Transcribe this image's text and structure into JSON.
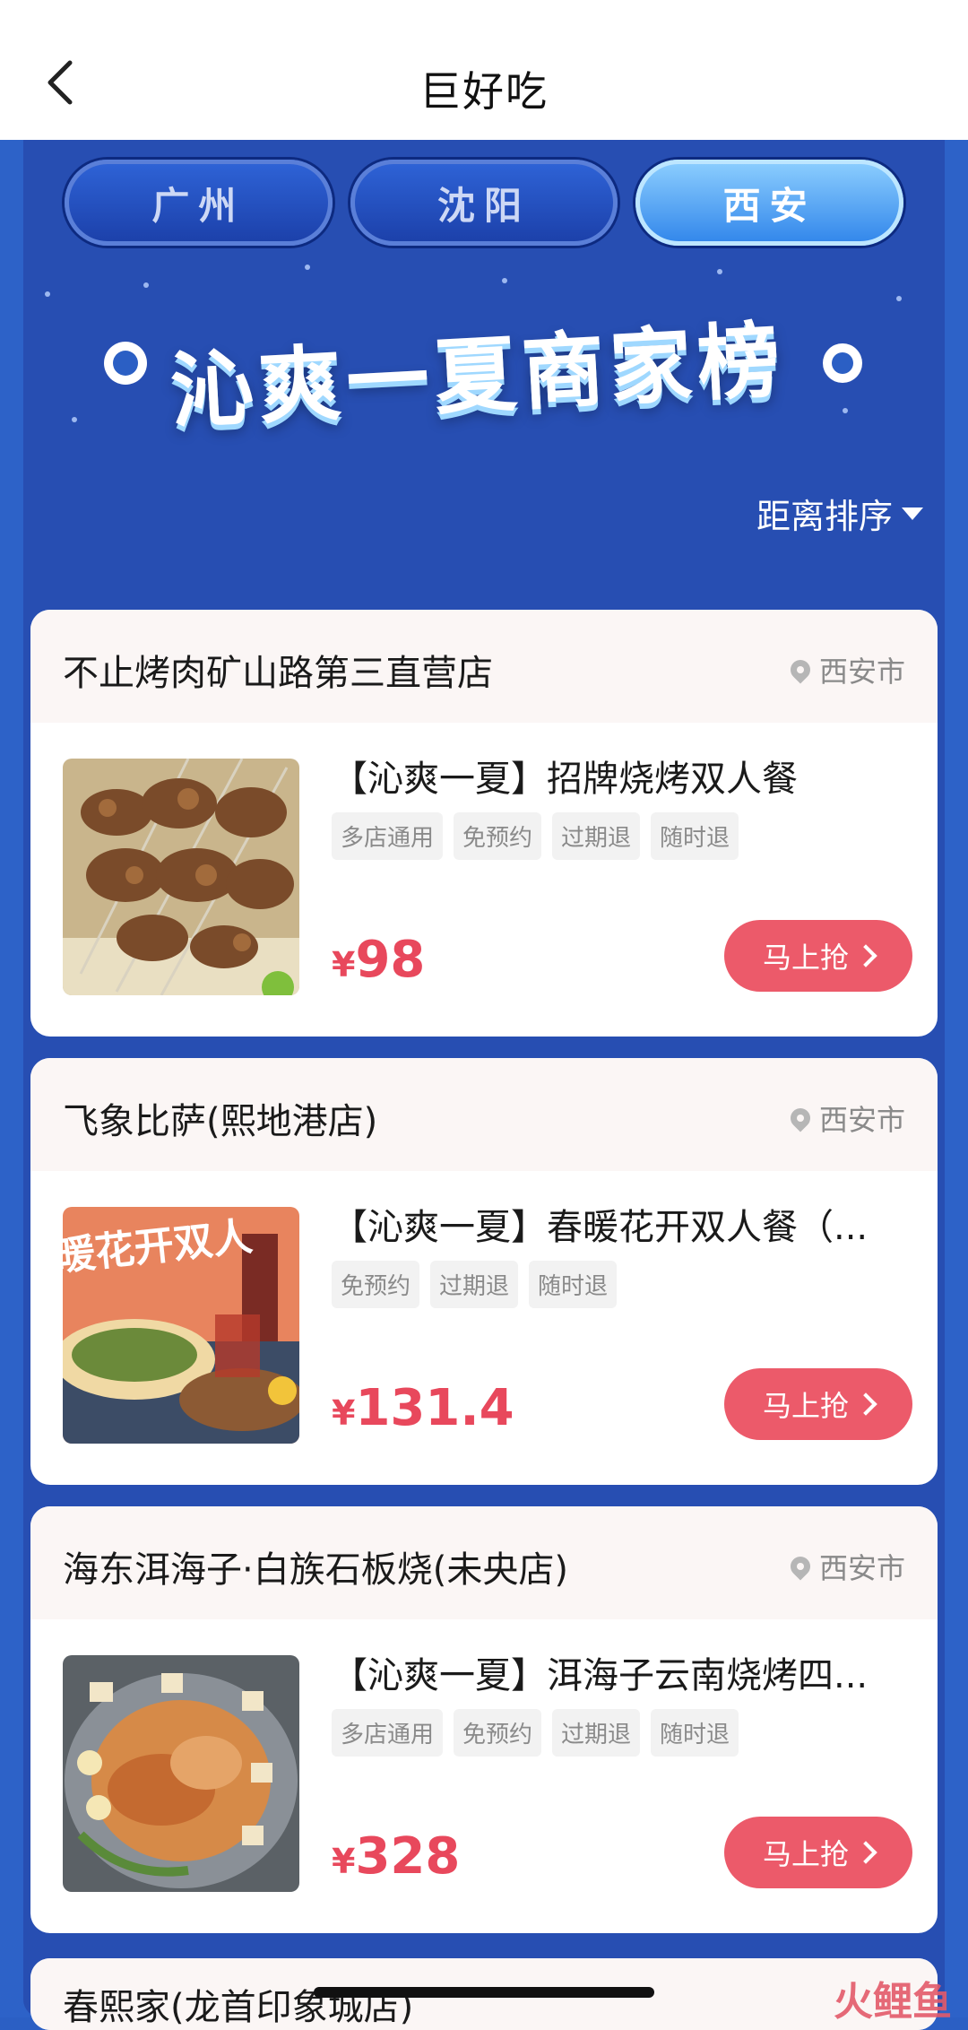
{
  "nav": {
    "title": "巨好吃"
  },
  "tabs": [
    "广州",
    "沈阳",
    "西安"
  ],
  "active_tab": "西安",
  "banner_title": "沁爽一夏商家榜",
  "sort_label": "距离排序",
  "cards": [
    {
      "store": "不止烤肉矿山路第三直营店",
      "city": "西安市",
      "deal": "【沁爽一夏】招牌烧烤双人餐",
      "tags": [
        "多店通用",
        "免预约",
        "过期退",
        "随时退"
      ],
      "currency": "¥",
      "price": "98",
      "button": "马上抢"
    },
    {
      "store": "飞象比萨(熙地港店)",
      "city": "西安市",
      "deal": "【沁爽一夏】春暖花开双人餐（...",
      "tags": [
        "免预约",
        "过期退",
        "随时退"
      ],
      "currency": "¥",
      "price": "131.4",
      "button": "马上抢",
      "image_text": "暖花开双人"
    },
    {
      "store": "海东洱海子·白族石板烧(未央店)",
      "city": "西安市",
      "deal": "【沁爽一夏】洱海子云南烧烤四...",
      "tags": [
        "多店通用",
        "免预约",
        "过期退",
        "随时退"
      ],
      "currency": "¥",
      "price": "328",
      "button": "马上抢"
    }
  ],
  "partial_card": {
    "store": "春熙家(龙首印象城店)"
  },
  "watermark": "火鲤鱼",
  "colors": {
    "accent": "#ec5a6a",
    "price": "#e8485c",
    "board": "#2d62c8"
  }
}
